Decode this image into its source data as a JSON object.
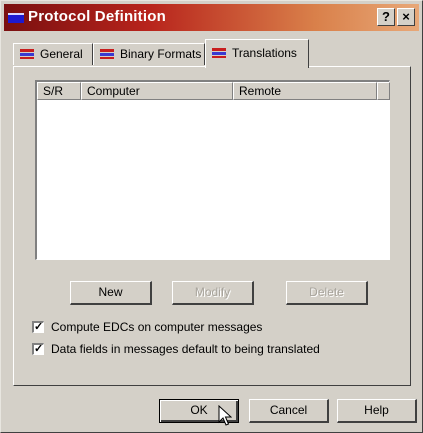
{
  "window": {
    "title": "Protocol Definition",
    "help_label": "?",
    "close_label": "×"
  },
  "tabs": [
    {
      "label": "General",
      "icon": "protocol-icon",
      "active": false
    },
    {
      "label": "Binary Formats",
      "icon": "protocol-icon",
      "active": false
    },
    {
      "label": "Translations",
      "icon": "protocol-icon",
      "active": true
    }
  ],
  "list": {
    "columns": [
      "S/R",
      "Computer",
      "Remote"
    ],
    "rows": []
  },
  "list_buttons": {
    "new": "New",
    "modify": "Modify",
    "delete": "Delete"
  },
  "options": {
    "compute_edcs": {
      "label": "Compute EDCs on computer messages",
      "checked": true
    },
    "default_translated": {
      "label": "Data fields in messages default to being translated",
      "checked": true
    }
  },
  "dialog_buttons": {
    "ok": "OK",
    "cancel": "Cancel",
    "help": "Help"
  },
  "colors": {
    "titlebar_start": "#7a1010",
    "titlebar_end": "#e8a878",
    "face": "#d4d0c8"
  }
}
